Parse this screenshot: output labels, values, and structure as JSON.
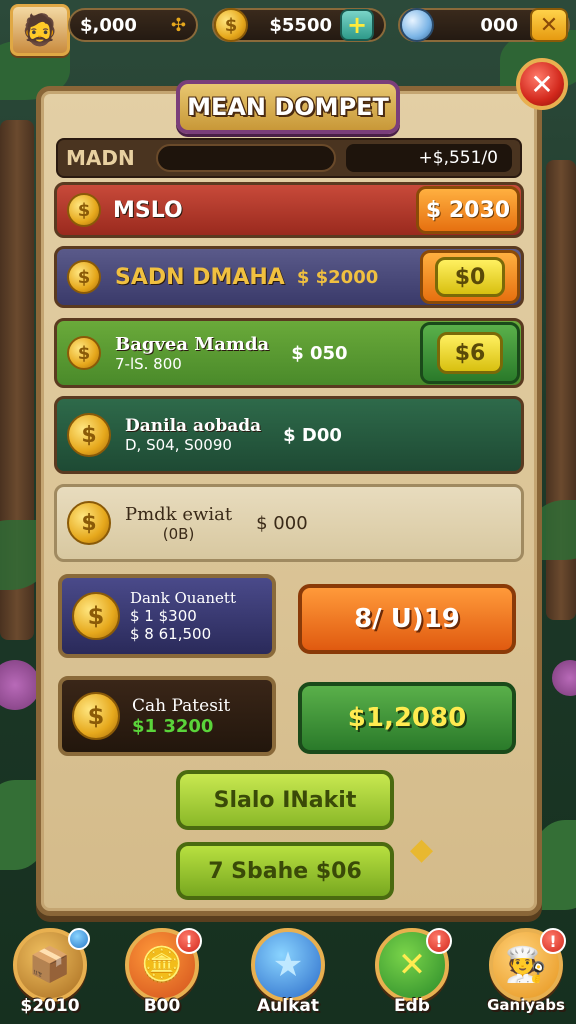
{
  "topbar": {
    "player_value": "$,000",
    "player_icon": "✣",
    "coins": "$5500",
    "coin_glyph": "$",
    "plus": "+",
    "gems": "000",
    "close_small": "✕"
  },
  "panel": {
    "title": "MEAN DOMPET",
    "close": "✕",
    "progress": {
      "label": "MADN",
      "value": "+$,551/0",
      "fill_percent": 0
    }
  },
  "rows": [
    {
      "name": "MSLO",
      "sub": "",
      "amount": "",
      "button": "$ 2030"
    },
    {
      "name": "SADN DMAHA",
      "sub": "",
      "amount": "$ $2000",
      "button": "$0"
    },
    {
      "name": "Bagvea Mamda",
      "sub": "7-lS. 800",
      "amount": "$ 050",
      "button": "$6"
    },
    {
      "name": "Danila aobada",
      "sub": "D, S04, S0090",
      "amount": "$ D00",
      "button": ""
    },
    {
      "name": "Pmdk ewiat",
      "sub": "(0B)",
      "amount": "$ 000",
      "button": ""
    }
  ],
  "boxes": {
    "box1": {
      "title": "Dank Ouanett",
      "line1": "$ 1 $300",
      "line2": "$ 8 61,500"
    },
    "box2": {
      "title": "Cah Patesit",
      "line1": "$1 3200"
    }
  },
  "buttons": {
    "orange": "8/ U)19",
    "green": "$1,2080",
    "lime1": "Slalo INakit",
    "lime2": "7 Sbahe $06"
  },
  "nav": [
    {
      "label": "$2010",
      "icon": "📦",
      "badge": ""
    },
    {
      "label": "B00",
      "icon": "🪙",
      "badge": "!"
    },
    {
      "label": "Aulkat",
      "icon": "★",
      "badge": ""
    },
    {
      "label": "Edb",
      "icon": "✕",
      "badge": "!"
    },
    {
      "label": "Ganiyabs",
      "icon": "🧑‍🍳",
      "badge": "!"
    }
  ],
  "colors": {
    "panel": "#e3cfa5",
    "title_border": "#7a3e7a",
    "accent_orange": "#e67010",
    "accent_green": "#2a7a2a"
  }
}
